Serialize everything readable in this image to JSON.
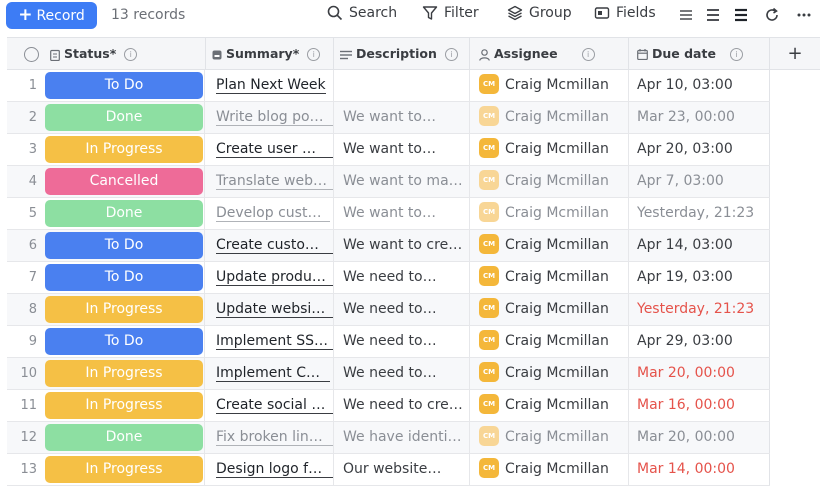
{
  "toolbar": {
    "record_label": "Record",
    "records_count": "13 records",
    "search_label": "Search",
    "filter_label": "Filter",
    "group_label": "Group",
    "fields_label": "Fields"
  },
  "columns": {
    "status": "Status*",
    "summary": "Summary*",
    "description": "Description",
    "assignee": "Assignee",
    "due_date": "Due date"
  },
  "colors": {
    "todo": "#4a80f0",
    "done": "#8ddfa2",
    "in_progress": "#f5c045",
    "cancelled": "#ee6b98",
    "overdue": "#e5534b",
    "primary": "#3d7cf5"
  },
  "rows": [
    {
      "num": "1",
      "status": "To Do",
      "summary": "Plan Next Week",
      "description": "",
      "assignee": "Craig Mcmillan",
      "initials": "CM",
      "due": "Apr 10, 03:00"
    },
    {
      "num": "2",
      "status": "Done",
      "summary": "Write blog post …",
      "description": "We want to…",
      "assignee": "Craig Mcmillan",
      "initials": "CM",
      "due": "Mar 23, 00:00"
    },
    {
      "num": "3",
      "status": "In Progress",
      "summary": "Create user ma…",
      "description": "We want to…",
      "assignee": "Craig Mcmillan",
      "initials": "CM",
      "due": "Apr 20, 03:00"
    },
    {
      "num": "4",
      "status": "Cancelled",
      "summary": "Translate websi…",
      "description": "We want to make…",
      "assignee": "Craig Mcmillan",
      "initials": "CM",
      "due": "Apr 7, 03:00"
    },
    {
      "num": "5",
      "status": "Done",
      "summary": "Develop custo…",
      "description": "We want to…",
      "assignee": "Craig Mcmillan",
      "initials": "CM",
      "due": "Yesterday, 21:23"
    },
    {
      "num": "6",
      "status": "To Do",
      "summary": "Create custom…",
      "description": "We want to creat…",
      "assignee": "Craig Mcmillan",
      "initials": "CM",
      "due": "Apr 14, 03:00"
    },
    {
      "num": "7",
      "status": "To Do",
      "summary": "Update produc…",
      "description": "We need to…",
      "assignee": "Craig Mcmillan",
      "initials": "CM",
      "due": "Apr 19, 03:00"
    },
    {
      "num": "8",
      "status": "In Progress",
      "summary": "Update website…",
      "description": "We need to…",
      "assignee": "Craig Mcmillan",
      "initials": "CM",
      "due": "Yesterday, 21:23"
    },
    {
      "num": "9",
      "status": "To Do",
      "summary": "Implement SSL …",
      "description": "We need to…",
      "assignee": "Craig Mcmillan",
      "initials": "CM",
      "due": "Apr 29, 03:00"
    },
    {
      "num": "10",
      "status": "In Progress",
      "summary": "Implement CR…",
      "description": "We need to…",
      "assignee": "Craig Mcmillan",
      "initials": "CM",
      "due": "Mar 20, 00:00"
    },
    {
      "num": "11",
      "status": "In Progress",
      "summary": "Create social m…",
      "description": "We need to creat…",
      "assignee": "Craig Mcmillan",
      "initials": "CM",
      "due": "Mar 16, 00:00"
    },
    {
      "num": "12",
      "status": "Done",
      "summary": "Fix broken links…",
      "description": "We have identifie…",
      "assignee": "Craig Mcmillan",
      "initials": "CM",
      "due": "Mar 20, 00:00"
    },
    {
      "num": "13",
      "status": "In Progress",
      "summary": "Design logo for …",
      "description": "Our website…",
      "assignee": "Craig Mcmillan",
      "initials": "CM",
      "due": "Mar 14, 00:00"
    }
  ]
}
